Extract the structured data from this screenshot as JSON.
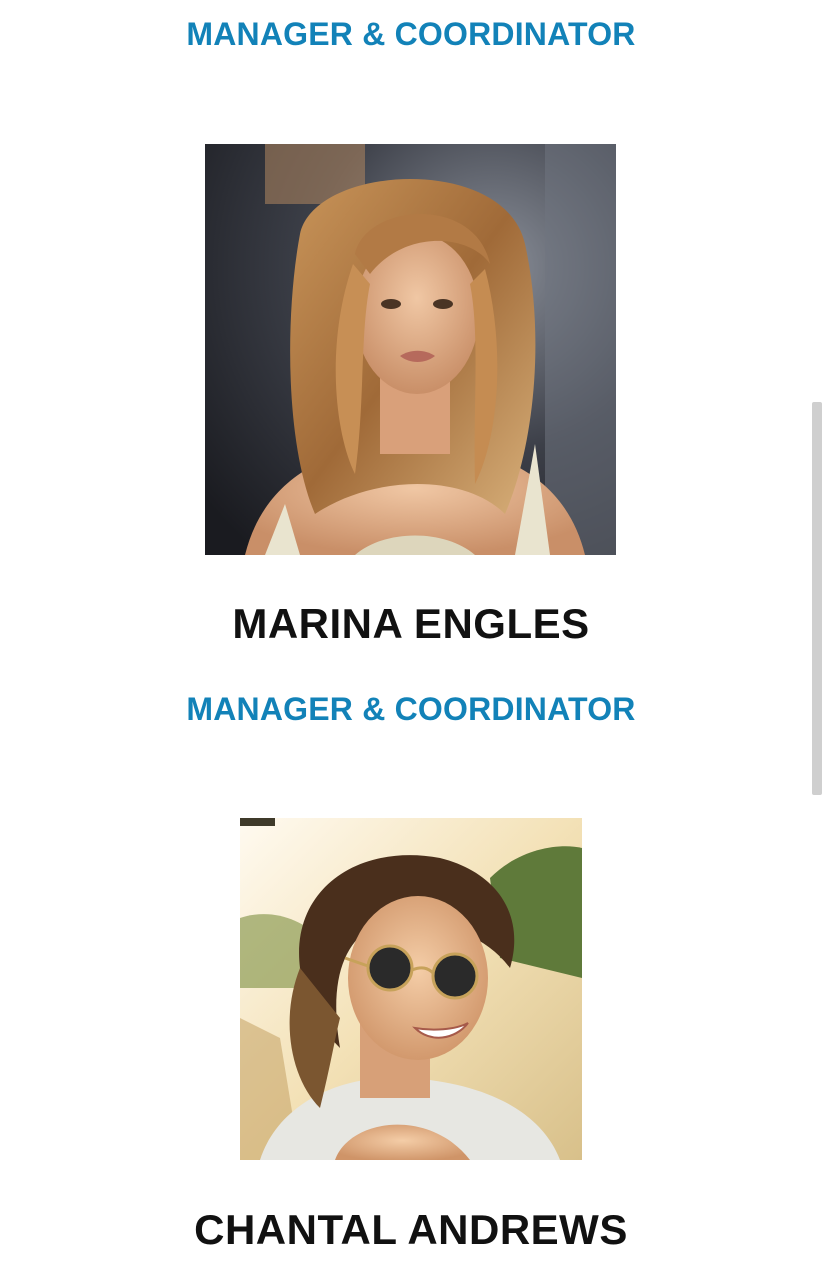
{
  "team": [
    {
      "role": "MANAGER & COORDINATOR"
    },
    {
      "photo_alt": "Portrait of Marina Engles",
      "name": "MARINA ENGLES",
      "role": "MANAGER & COORDINATOR"
    },
    {
      "photo_alt": "Portrait of Chantal Andrews",
      "name": "CHANTAL ANDREWS"
    }
  ],
  "colors": {
    "role_text": "#1282b8",
    "name_text": "#111111"
  }
}
